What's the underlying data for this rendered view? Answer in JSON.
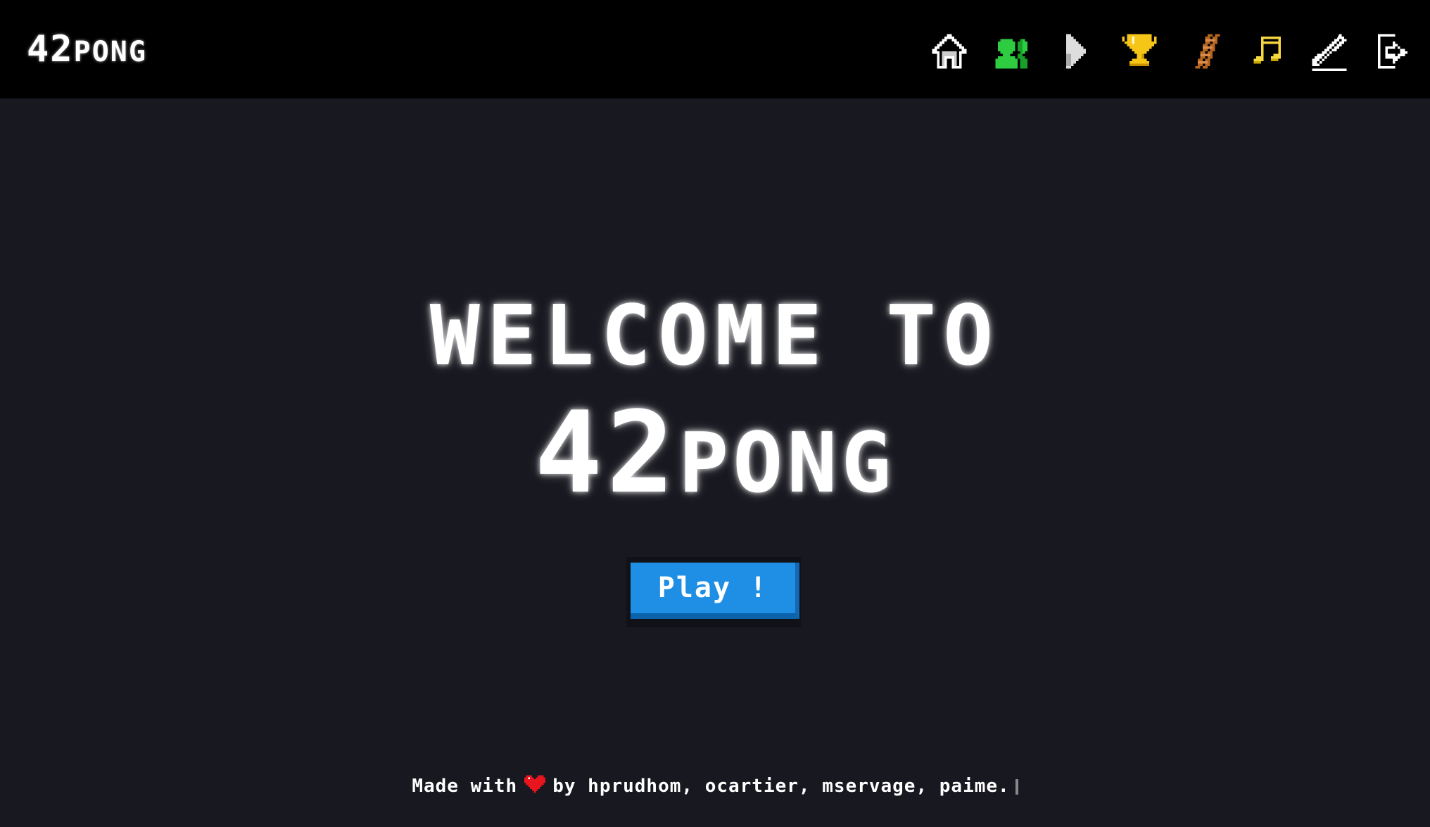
{
  "navbar": {
    "logo_number": "42",
    "logo_word": "PONG",
    "icons": [
      {
        "name": "home-icon",
        "label": "Home"
      },
      {
        "name": "friends-icon",
        "label": "Friends",
        "color": "#2ecc40"
      },
      {
        "name": "play-icon",
        "label": "Play",
        "color": "#dddddd"
      },
      {
        "name": "trophy-icon",
        "label": "Trophy",
        "color": "#f5c518"
      },
      {
        "name": "ladder-icon",
        "label": "Ladder",
        "color": "#b5651d"
      },
      {
        "name": "music-icon",
        "label": "Music",
        "color": "#f5d742"
      },
      {
        "name": "edit-icon",
        "label": "Edit"
      },
      {
        "name": "logout-icon",
        "label": "Logout"
      }
    ]
  },
  "main": {
    "headline_line1": "WELCOME TO",
    "headline_number": "42",
    "headline_word": "PONG",
    "play_button_label": "Play !"
  },
  "footer": {
    "prefix": "Made with",
    "suffix": "by hprudhom, ocartier, mservage, paime."
  },
  "colors": {
    "navbar_bg": "#000000",
    "page_bg": "#181920",
    "accent": "#1e8fe4",
    "heart": "#e8141e"
  }
}
